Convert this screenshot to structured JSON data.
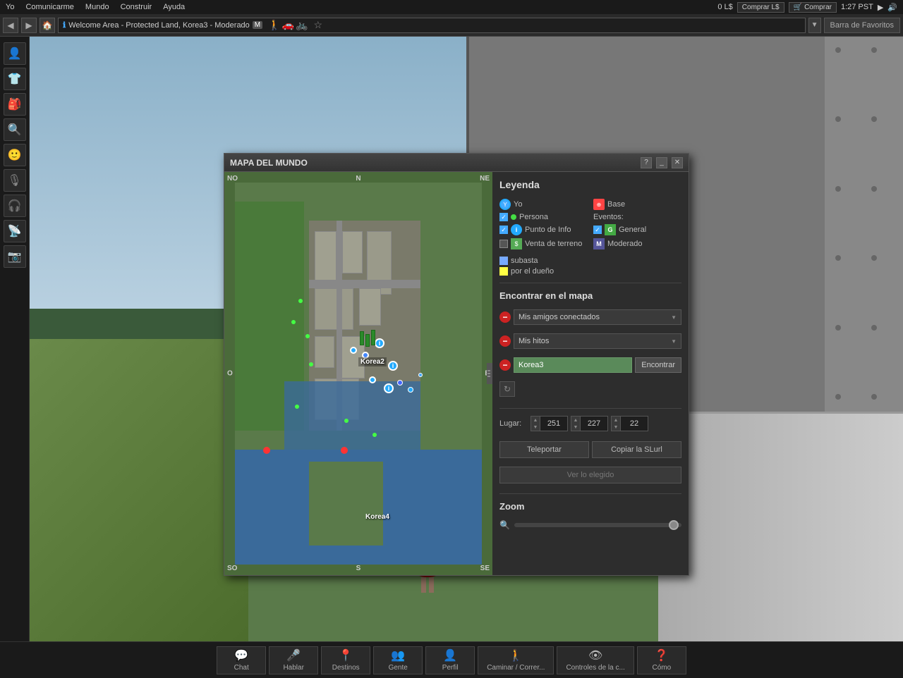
{
  "topbar": {
    "menu_items": [
      "Yo",
      "Comunicarme",
      "Mundo",
      "Construir",
      "Ayuda"
    ],
    "balance": "0 L$",
    "buy_currency_label": "Comprar L$",
    "buy_label": "Comprar",
    "time": "1:27 PST",
    "location_text": "Welcome Area - Protected Land, Korea3 - Moderado",
    "location_badge": "M",
    "favorites_label": "Barra de Favoritos"
  },
  "sidebar": {
    "icons": [
      "person-icon",
      "shirt-icon",
      "suitcase-icon",
      "search-icon",
      "profile-icon",
      "mic-icon",
      "headphone-icon",
      "radio-icon",
      "camera-icon"
    ]
  },
  "map_dialog": {
    "title": "MAPA DEL MUNDO",
    "compass": {
      "no": "NO",
      "n": "N",
      "ne": "NE",
      "o": "O",
      "e": "E",
      "so": "SO",
      "s": "S",
      "se": "SE"
    },
    "labels": [
      "Korea2",
      "Korea4"
    ],
    "legend": {
      "title": "Leyenda",
      "yo_label": "Yo",
      "base_label": "Base",
      "persona_label": "Persona",
      "punto_info_label": "Punto de Info",
      "venta_terreno_label": "Venta de terreno",
      "subasta_label": "subasta",
      "por_dueno_label": "por el dueño",
      "eventos_label": "Eventos:",
      "general_label": "General",
      "moderado_label": "Moderado"
    },
    "find_section": {
      "title": "Encontrar en el mapa",
      "row1_label": "Mis amigos conectados",
      "row2_label": "Mis hitos",
      "row3_input": "Korea3",
      "find_btn": "Encontrar"
    },
    "location": {
      "label": "Lugar:",
      "x": "251",
      "y": "227",
      "z": "22"
    },
    "buttons": {
      "teleportar": "Teleportar",
      "copiar_slurl": "Copiar la SLurl",
      "ver_elegido": "Ver lo elegido"
    },
    "zoom": {
      "title": "Zoom"
    }
  },
  "taskbar": {
    "items": [
      {
        "icon": "💬",
        "label": "Chat"
      },
      {
        "icon": "🎤",
        "label": "Hablar"
      },
      {
        "icon": "📍",
        "label": "Destinos"
      },
      {
        "icon": "👥",
        "label": "Gente"
      },
      {
        "icon": "👤",
        "label": "Perfil"
      },
      {
        "icon": "🚶",
        "label": "Caminar / Correr..."
      },
      {
        "icon": "👁",
        "label": "Controles de la c..."
      },
      {
        "icon": "❓",
        "label": "Cómo"
      }
    ]
  }
}
